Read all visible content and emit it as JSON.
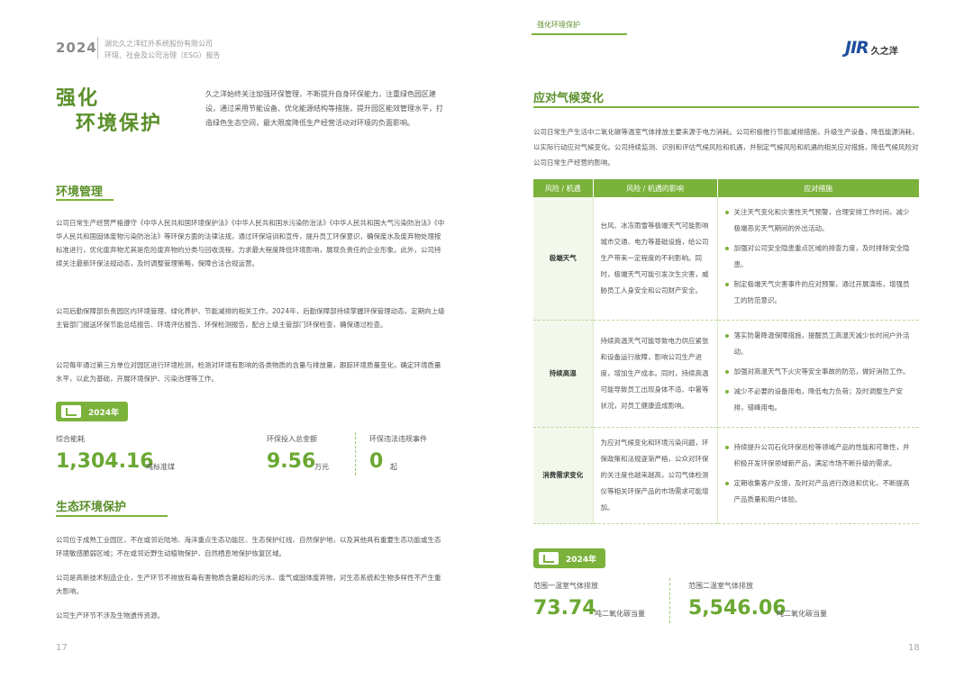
{
  "left": {
    "header": {
      "year": "2024",
      "company": "湖北久之洋红外系统股份有限公司",
      "report": "环境、社会及公司治理（ESG）报告"
    },
    "title_line1": "强化",
    "title_line2": "环境保护",
    "intro": "久之洋始终关注加强环保管理，不断提升自身环保能力，注重绿色园区建设，通过采用节能设备、优化能源结构等措施，提升园区能效管理水平，打造绿色生态空间，最大限度降低生产经营活动对环境的负面影响。",
    "env_mgmt": {
      "heading": "环境管理",
      "paras": [
        "公司日常生产经营严格遵守《中华人民共和国环境保护法》《中华人民共和国水污染防治法》《中华人民共和国大气污染防治法》《中华人民共和国固体废物污染防治法》等环保方面的法律法规，通过环保培训和宣传，提升员工环保意识，确保废水及废弃物处理按标准进行，优化废弃物尤其是危险废弃物的分类与回收流程，力求最大程度降低环境影响，展现负责任的企业形象。此外，公司持续关注最新环保法规动态，及时调整管理策略，保障合法合规运营。",
        "公司后勤保障部负责园区内环境管理、绿化养护、节能减排的相关工作。2024年，后勤保障部持续掌握环保管理动态，定期向上级主管部门报送环保节能总结报告、环境评估报告、环保检测报告，配合上级主管部门环保检查，确保通过检查。",
        "公司每年通过第三方单位对园区进行环境检测，检测对环境有影响的各类物质的含量与排放量，跟踪环境质量变化，确定环境质量水平，以此为基础，开展环境保护、污染治理等工作。"
      ]
    },
    "badge": "2024年",
    "metrics": [
      {
        "label": "综合能耗",
        "value": "1,304.16",
        "unit": "吨标准煤"
      },
      {
        "label": "环保投入总金额",
        "value": "9.56",
        "unit": "万元"
      },
      {
        "label": "环保违法违规事件",
        "value": "0",
        "unit": "起"
      }
    ],
    "eco": {
      "heading": "生态环境保护",
      "paras": [
        "公司位于成熟工业园区，不在或邻近陆地、海洋重点生态功能区、生态保护红线、自然保护地，以及其他具有重要生态功能或生态环境敏感脆弱区域；不在或邻近野生动植物保护、自然栖息地保护恢复区域。",
        "公司是高新技术制造企业，生产环节不排放有毒有害物质含量超标的污水、废气或固体废弃物，对生态系统和生物多样性不产生重大影响。",
        "公司生产环节不涉及生物遗传资源。"
      ]
    },
    "page": "17"
  },
  "right": {
    "tab": "强化环境保护",
    "logo": {
      "mark": "JIR",
      "cn": "久之洋"
    },
    "heading": "应对气候变化",
    "desc": "公司日常生产生活中二氧化碳等温室气体排放主要来源于电力消耗。公司积极推行节能减排措施，升级生产设备，降低能源消耗，以实际行动应对气候变化。公司持续监测、识别和评估气候风险和机遇，并制定气候风险和机遇的相关应对措施，降低气候风险对公司日常生产经营的影响。",
    "table": {
      "headers": [
        "风险 / 机遇",
        "风险 / 机遇的影响",
        "应对措施"
      ],
      "rows": [
        {
          "cat": "极端天气",
          "impact": "台风、冰冻雨雪等极端天气可能影响城市交通、电力等基础设施，给公司生产带来一定程度的不利影响。同时，极端天气可能引发次生灾害，威胁员工人身安全和公司财产安全。",
          "measures": [
            "关注天气变化和灾害性天气预警，合理安排工作时间，减少极端恶劣天气期间的外出活动。",
            "加强对公司安全隐患重点区域的排查力度，及时排除安全隐患。",
            "制定极端天气灾害事件的应对预案，通过开展演练，增强员工的防范意识。"
          ]
        },
        {
          "cat": "持续高温",
          "impact": "持续高温天气可能导致电力供应紧张和设备运行故障，影响公司生产进度，增加生产成本。同时，持续高温可能导致员工出现身体不适、中暑等状况，对员工健康造成影响。",
          "measures": [
            "落实防暑降温保障措施，提醒员工高温天减少长时间户外活动。",
            "加强对高温天气下火灾等安全事故的防范，做好消防工作。",
            "减少不必要的设备用电，降低电力负荷；及时调整生产安排，错峰用电。"
          ]
        },
        {
          "cat": "消费需求变化",
          "impact": "为应对气候变化和环境污染问题，环保政策和法规逐渐严格，公众对环保的关注度也越来越高，公司气体检测仪等相关环保产品的市场需求可能增加。",
          "measures": [
            "持续提升公司石化环保巡检等领域产品的性能和可靠性，并积极开发环保领域新产品，满足市场不断升级的需求。",
            "定期收集客户反馈，及时对产品进行改进和优化，不断提高产品质量和用户体验。"
          ]
        }
      ]
    },
    "badge": "2024年",
    "metrics": [
      {
        "label": "范围一温室气体排放",
        "value": "73.74",
        "unit": "吨二氧化碳当量"
      },
      {
        "label": "范围二温室气体排放",
        "value": "5,546.06",
        "unit": "吨二氧化碳当量"
      }
    ],
    "page": "18"
  }
}
